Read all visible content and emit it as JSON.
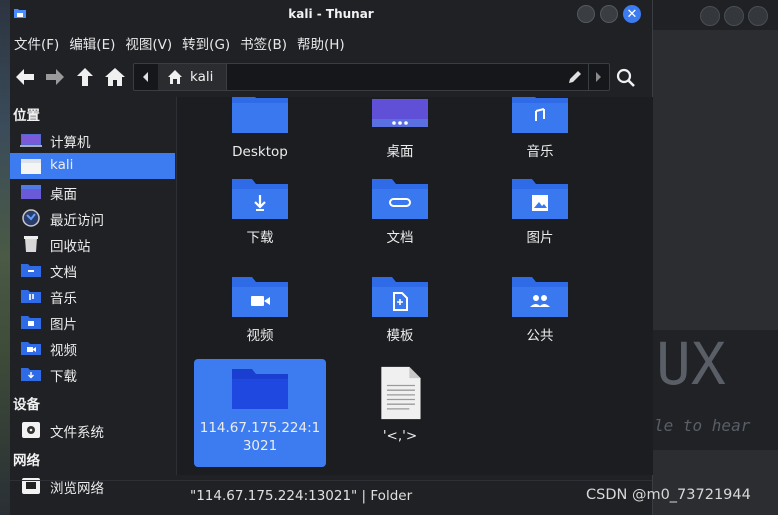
{
  "window": {
    "title": "kali - Thunar"
  },
  "menubar": [
    "文件(F)",
    "编辑(E)",
    "视图(V)",
    "转到(G)",
    "书签(B)",
    "帮助(H)"
  ],
  "location": {
    "crumb": "kali"
  },
  "sidebar": {
    "places_header": "位置",
    "places": [
      {
        "label": "计算机",
        "icon": "computer-icon"
      },
      {
        "label": "kali",
        "icon": "home-folder-icon",
        "active": true
      },
      {
        "label": "桌面",
        "icon": "desktop-icon"
      },
      {
        "label": "最近访问",
        "icon": "recent-icon"
      },
      {
        "label": "回收站",
        "icon": "trash-icon"
      },
      {
        "label": "文档",
        "icon": "documents-folder-icon"
      },
      {
        "label": "音乐",
        "icon": "music-folder-icon"
      },
      {
        "label": "图片",
        "icon": "pictures-folder-icon"
      },
      {
        "label": "视频",
        "icon": "videos-folder-icon"
      },
      {
        "label": "下载",
        "icon": "downloads-folder-icon"
      }
    ],
    "devices_header": "设备",
    "devices": [
      {
        "label": "文件系统",
        "icon": "drive-icon"
      }
    ],
    "network_header": "网络",
    "network": [
      {
        "label": "浏览网络",
        "icon": "network-icon"
      }
    ]
  },
  "files": [
    {
      "name": "Desktop",
      "icon": "folder-desktop-icon"
    },
    {
      "name": "桌面",
      "icon": "folder-desktop-icon"
    },
    {
      "name": "音乐",
      "icon": "folder-music-icon"
    },
    {
      "name": "下载",
      "icon": "folder-download-icon"
    },
    {
      "name": "文档",
      "icon": "folder-documents-icon"
    },
    {
      "name": "图片",
      "icon": "folder-pictures-icon"
    },
    {
      "name": "视频",
      "icon": "folder-videos-icon"
    },
    {
      "name": "模板",
      "icon": "folder-templates-icon"
    },
    {
      "name": "公共",
      "icon": "folder-public-icon"
    },
    {
      "name": "114.67.175.224:13021",
      "icon": "folder-icon",
      "selected": true
    },
    {
      "name": "'<,'>",
      "icon": "text-file-icon"
    }
  ],
  "status": {
    "text": "\"114.67.175.224:13021\" | Folder"
  },
  "watermark": "CSDN @m0_73721944",
  "colors": {
    "accent": "#3d7cf0",
    "folder": "#2f6be6",
    "background": "#1f2125"
  }
}
